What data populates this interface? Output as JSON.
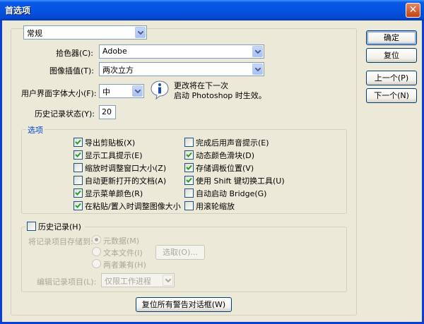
{
  "window": {
    "title": "首选项",
    "close_glyph": "✕"
  },
  "section_select": {
    "value": "常规"
  },
  "color_picker": {
    "label": "拾色器(C):",
    "value": "Adobe"
  },
  "interpolation": {
    "label": "图像插值(T):",
    "value": "两次立方"
  },
  "font_size": {
    "label": "用户界面字体大小(F):",
    "value": "中"
  },
  "info_note": {
    "line1": "更改将在下一次",
    "line2": "启动 Photoshop 时生效。"
  },
  "history_states": {
    "label": "历史记录状态(Y):",
    "value": "20"
  },
  "options": {
    "title": "选项",
    "items": [
      {
        "label": "导出剪贴板(X)",
        "checked": true
      },
      {
        "label": "显示工具提示(E)",
        "checked": true
      },
      {
        "label": "缩放时调整窗口大小(Z)",
        "checked": false
      },
      {
        "label": "自动更新打开的文档(A)",
        "checked": false
      },
      {
        "label": "显示菜单颜色(R)",
        "checked": true
      },
      {
        "label": "在粘贴/置入时调整图像大小",
        "checked": true
      },
      {
        "label": "完成后用声音提示(E)",
        "checked": false
      },
      {
        "label": "动态颜色滑块(D)",
        "checked": true
      },
      {
        "label": "存储调板位置(V)",
        "checked": true
      },
      {
        "label": "使用 Shift 键切换工具(U)",
        "checked": true
      },
      {
        "label": "自动启动 Bridge(G)",
        "checked": false
      },
      {
        "label": "用滚轮缩放",
        "checked": false
      }
    ]
  },
  "history_log": {
    "label": "历史记录(H)",
    "checked": false,
    "save_to_label": "将记录项目存储到:",
    "radio_metadata": "元数据(M)",
    "radio_textfile": "文本文件(I)",
    "radio_both": "两者兼有(H)",
    "choose_button": "选取(O)...",
    "edit_log_label": "编辑记录项目(L):",
    "edit_log_value": "仅限工作进程"
  },
  "reset_warnings_button": "复位所有警告对话框(W)",
  "buttons": {
    "ok": "确定",
    "reset": "复位",
    "prev": "上一个(P)",
    "next": "下一个(N)"
  },
  "colors": {
    "titlebar": "#0553e0",
    "dialog_bg": "#ece9d8",
    "group_title": "#0046d5"
  }
}
